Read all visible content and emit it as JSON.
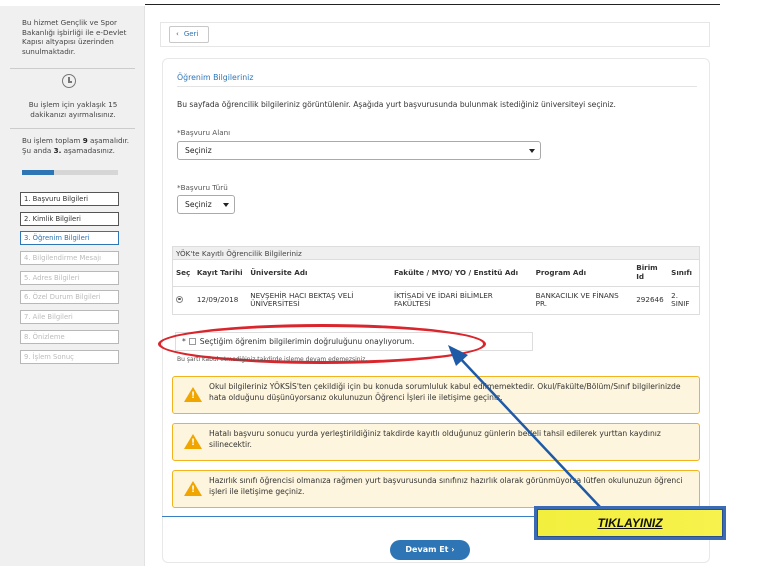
{
  "sidebar": {
    "info_text": "Bu hizmet Gençlik ve Spor Bakanlığı işbirliği ile e-Devlet Kapısı altyapısı üzerinden sunulmaktadır.",
    "time_text": "Bu işlem için yaklaşık 15 dakikanızı ayırmalısınız.",
    "steps_prefix": "Bu işlem toplam ",
    "steps_total": "9",
    "steps_middle": " aşamalıdır. Şu anda ",
    "steps_current": "3.",
    "steps_suffix": " aşamadasınız.",
    "progress_fraction": 0.33,
    "menu": [
      {
        "label": "1. Başvuru Bilgileri",
        "state": "done"
      },
      {
        "label": "2. Kimlik Bilgileri",
        "state": "done"
      },
      {
        "label": "3. Öğrenim Bilgileri",
        "state": "active"
      },
      {
        "label": "4. Bilgilendirme Mesajı",
        "state": "pending"
      },
      {
        "label": "5. Adres Bilgileri",
        "state": "pending"
      },
      {
        "label": "6. Özel Durum Bilgileri",
        "state": "pending"
      },
      {
        "label": "7. Aile Bilgileri",
        "state": "pending"
      },
      {
        "label": "8. Önizleme",
        "state": "pending"
      },
      {
        "label": "9. İşlem Sonuç",
        "state": "pending"
      }
    ]
  },
  "header": {
    "back_label": "Geri"
  },
  "main": {
    "title": "Öğrenim Bilgileriniz",
    "description": "Bu sayfada öğrencilik bilgileriniz görüntülenir. Aşağıda yurt başvurusunda bulunmak istediğiniz üniversiteyi seçiniz.",
    "application_area_label": "*Başvuru Alanı",
    "application_area_value": "Seçiniz",
    "application_type_label": "*Başvuru Türü",
    "application_type_value": "Seçiniz"
  },
  "table": {
    "caption": "YÖK'te Kayıtlı Öğrencilik Bilgileriniz",
    "headers": [
      "Seç",
      "Kayıt Tarihi",
      "Üniversite Adı",
      "Fakülte / MYO/ YO / Enstitü Adı",
      "Program Adı",
      "Birim Id",
      "Sınıfı"
    ],
    "rows": [
      [
        "",
        "12/09/2018",
        "NEVŞEHİR HACI BEKTAŞ VELİ ÜNİVERSİTESİ",
        "İKTİSADİ VE İDARİ BİLİMLER FAKÜLTESİ",
        "BANKACILIK VE FİNANS PR.",
        "292646",
        "2. SINIF"
      ]
    ]
  },
  "approval": {
    "star": "*",
    "label": "Seçtiğim öğrenim bilgilerimin doğruluğunu onaylıyorum.",
    "note": "Bu şartı kabul etmediğiniz takdirde işleme devam edemezsiniz."
  },
  "warnings": [
    "Okul bilgileriniz YÖKSİS'ten çekildiği için bu konuda sorumluluk kabul edilmemektedir. Okul/Fakülte/Bölüm/Sınıf bilgilerinizde hata olduğunu düşünüyorsanız okulunuzun Öğrenci İşleri ile iletişime geçiniz.",
    "Hatalı başvuru sonucu yurda yerleştirildiğiniz takdirde kayıtlı olduğunuz günlerin bedeli tahsil edilerek yurttan kaydınız silinecektir.",
    "Hazırlık sınıfı öğrencisi olmanıza rağmen yurt başvurusunda sınıfınız hazırlık olarak görünmüyorsa lütfen okulunuzun öğrenci işleri ile iletişime geçiniz."
  ],
  "continue_label": "Devam Et",
  "callout": {
    "text": "TIKLAYINIZ"
  },
  "colors": {
    "primary": "#2e75b6",
    "highlight_oval": "#d9252b",
    "warning_bg": "#fdf5dd",
    "warning_border": "#f2b31f",
    "callout_bg": "#f3ef3e"
  }
}
